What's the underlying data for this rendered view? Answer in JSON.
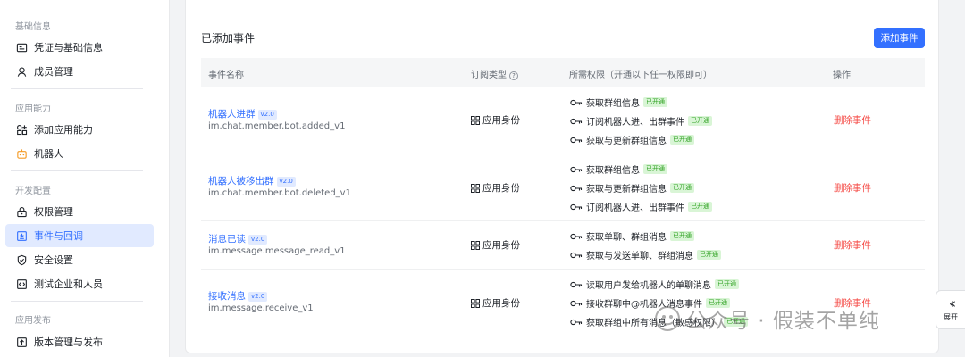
{
  "sidebar": {
    "groups": [
      {
        "title": "基础信息",
        "items": [
          {
            "label": "凭证与基础信息",
            "icon": "credential-icon"
          },
          {
            "label": "成员管理",
            "icon": "user-icon"
          }
        ]
      },
      {
        "title": "应用能力",
        "items": [
          {
            "label": "添加应用能力",
            "icon": "add-capability-icon"
          },
          {
            "label": "机器人",
            "icon": "robot-icon"
          }
        ]
      },
      {
        "title": "开发配置",
        "items": [
          {
            "label": "权限管理",
            "icon": "lock-icon"
          },
          {
            "label": "事件与回调",
            "icon": "event-icon",
            "active": true
          },
          {
            "label": "安全设置",
            "icon": "shield-icon"
          },
          {
            "label": "测试企业和人员",
            "icon": "test-icon"
          }
        ]
      },
      {
        "title": "应用发布",
        "items": [
          {
            "label": "版本管理与发布",
            "icon": "upload-icon"
          }
        ]
      }
    ]
  },
  "main": {
    "title": "已添加事件",
    "add_button": "添加事件",
    "columns": {
      "name": "事件名称",
      "type": "订阅类型",
      "perms": "所需权限（开通以下任一权限即可）",
      "action": "操作"
    },
    "events": [
      {
        "name": "机器人进群",
        "version": "v2.0",
        "code": "im.chat.member.bot.added_v1",
        "identity": "应用身份",
        "permissions": [
          {
            "label": "获取群组信息",
            "status": "已开通"
          },
          {
            "label": "订阅机器人进、出群事件",
            "status": "已开通"
          },
          {
            "label": "获取与更新群组信息",
            "status": "已开通"
          }
        ],
        "action": "删除事件"
      },
      {
        "name": "机器人被移出群",
        "version": "v2.0",
        "code": "im.chat.member.bot.deleted_v1",
        "identity": "应用身份",
        "permissions": [
          {
            "label": "获取群组信息",
            "status": "已开通"
          },
          {
            "label": "获取与更新群组信息",
            "status": "已开通"
          },
          {
            "label": "订阅机器人进、出群事件",
            "status": "已开通"
          }
        ],
        "action": "删除事件"
      },
      {
        "name": "消息已读",
        "version": "v2.0",
        "code": "im.message.message_read_v1",
        "identity": "应用身份",
        "permissions": [
          {
            "label": "获取单聊、群组消息",
            "status": "已开通"
          },
          {
            "label": "获取与发送单聊、群组消息",
            "status": "已开通"
          }
        ],
        "action": "删除事件"
      },
      {
        "name": "接收消息",
        "version": "v2.0",
        "code": "im.message.receive_v1",
        "identity": "应用身份",
        "permissions": [
          {
            "label": "读取用户发给机器人的单聊消息",
            "status": "已开通"
          },
          {
            "label": "接收群聊中@机器人消息事件",
            "status": "已开通"
          },
          {
            "label": "获取群组中所有消息（敏感权限）",
            "status": "已开通"
          }
        ],
        "action": "删除事件"
      }
    ]
  },
  "expand_panel": {
    "label": "展开"
  },
  "watermark": {
    "text": "公众号 · 假装不单纯"
  },
  "colors": {
    "accent": "#3370ff",
    "danger": "#f54a45",
    "success": "#2ea121"
  }
}
